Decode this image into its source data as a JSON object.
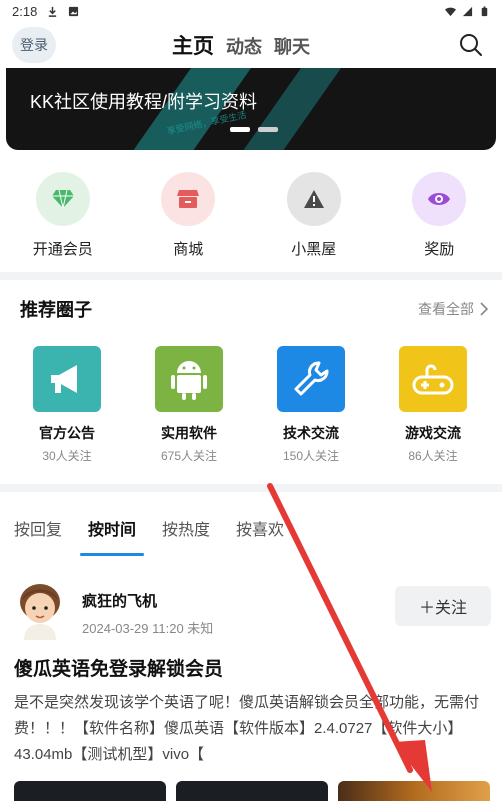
{
  "status_bar": {
    "time": "2:18"
  },
  "header": {
    "login_label": "登录",
    "tabs": [
      "主页",
      "动态",
      "聊天"
    ]
  },
  "banner": {
    "title": "KK社区使用教程/附学习资料",
    "watermark": "享受网络，享受生活"
  },
  "quick_nav": [
    {
      "label": "开通会员",
      "icon": "diamond-icon",
      "color": "#49b86a"
    },
    {
      "label": "商城",
      "icon": "store-icon",
      "color": "#e35b5b"
    },
    {
      "label": "小黑屋",
      "icon": "warning-icon",
      "color": "#4a4a4a"
    },
    {
      "label": "奖励",
      "icon": "eye-icon",
      "color": "#9b4bd8"
    }
  ],
  "recommended": {
    "title": "推荐圈子",
    "more": "查看全部",
    "items": [
      {
        "name": "官方公告",
        "count": "30人关注",
        "icon": "megaphone-icon",
        "color": "#3bb3ae"
      },
      {
        "name": "实用软件",
        "count": "675人关注",
        "icon": "android-icon",
        "color": "#7cb342"
      },
      {
        "name": "技术交流",
        "count": "150人关注",
        "icon": "wrench-icon",
        "color": "#1e88e5"
      },
      {
        "name": "游戏交流",
        "count": "86人关注",
        "icon": "gamepad-icon",
        "color": "#f0c419"
      }
    ]
  },
  "sort_tabs": [
    "按回复",
    "按时间",
    "按热度",
    "按喜欢"
  ],
  "post": {
    "author": "疯狂的飞机",
    "meta": "2024-03-29 11:20 未知",
    "follow": "＋关注",
    "title": "傻瓜英语免登录解锁会员",
    "body": "是不是突然发现该学个英语了呢！傻瓜英语解锁会员全部功能，无需付费！！！【软件名称】傻瓜英语【软件版本】2.4.0727【软件大小】43.04mb【测试机型】vivo【"
  }
}
